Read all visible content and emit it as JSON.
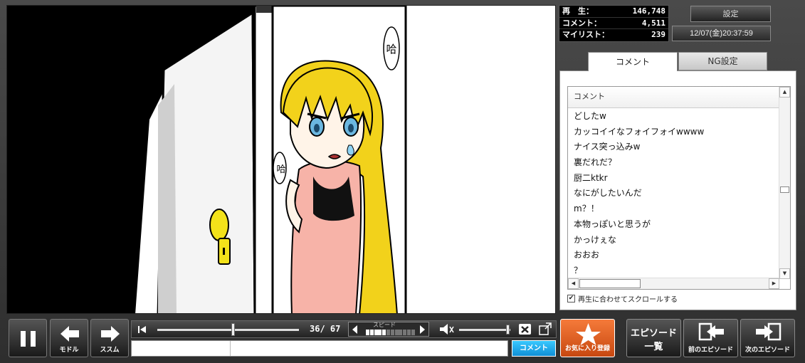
{
  "stats": {
    "views_label": "再　生：",
    "views": "146,748",
    "comments_label": "コメント：",
    "comments": "4,511",
    "mylist_label": "マイリスト：",
    "mylist": "239"
  },
  "header": {
    "settings_label": "設定",
    "datetime": "12/07(金)20:37:59"
  },
  "tabs": [
    {
      "label": "コメント",
      "active": true
    },
    {
      "label": "NG設定",
      "active": false
    }
  ],
  "comment_list": {
    "header": "コメント",
    "rows": [
      "どしたw",
      "カッコイイなフォイフォイwwww",
      "ナイス突っ込みw",
      "裏だれだ？",
      "厨二ktkr",
      "なにがしたいんだ",
      "m？！",
      "本物っぽいと思うが",
      "かっけぇな",
      "おおお",
      "？"
    ],
    "autoscroll_label": "再生に合わせてスクロールする",
    "autoscroll_checked": true
  },
  "manga": {
    "sfx_top": "哈",
    "sfx_mid": "哈"
  },
  "controls": {
    "back_label": "モドル",
    "forward_label": "ススム",
    "page_current": 36,
    "page_total": 67,
    "page_display": "36/ 67",
    "speed_label": "スピード",
    "speed_level": 5,
    "speed_max": 12,
    "volume": 0.95,
    "comment_placeholder": "",
    "comment_submit_label": "コメント"
  },
  "actions": {
    "favorite_label": "お気に入り登録",
    "episode_list_label_1": "エピソード",
    "episode_list_label_2": "一覧",
    "prev_episode_label": "前のエピソード",
    "next_episode_label": "次のエピソード"
  },
  "colors": {
    "accent_blue": "#1aa7ec",
    "favorite_orange": "#e0622a",
    "hair_yellow": "#f2d21b",
    "dress_pink": "#f7b3a8",
    "knob_yellow": "#f3e21a"
  },
  "icons": {
    "pause": "pause-icon",
    "back": "arrow-left-icon",
    "forward": "arrow-right-icon",
    "first_page": "skip-start-icon",
    "speed_down": "arrow-left-small-icon",
    "speed_up": "arrow-right-small-icon",
    "volume": "speaker-icon",
    "comment_toggle": "comment-off-icon",
    "fullscreen": "fullscreen-icon",
    "favorite": "star-icon",
    "prev_episode": "prev-episode-icon",
    "next_episode": "next-episode-icon"
  }
}
